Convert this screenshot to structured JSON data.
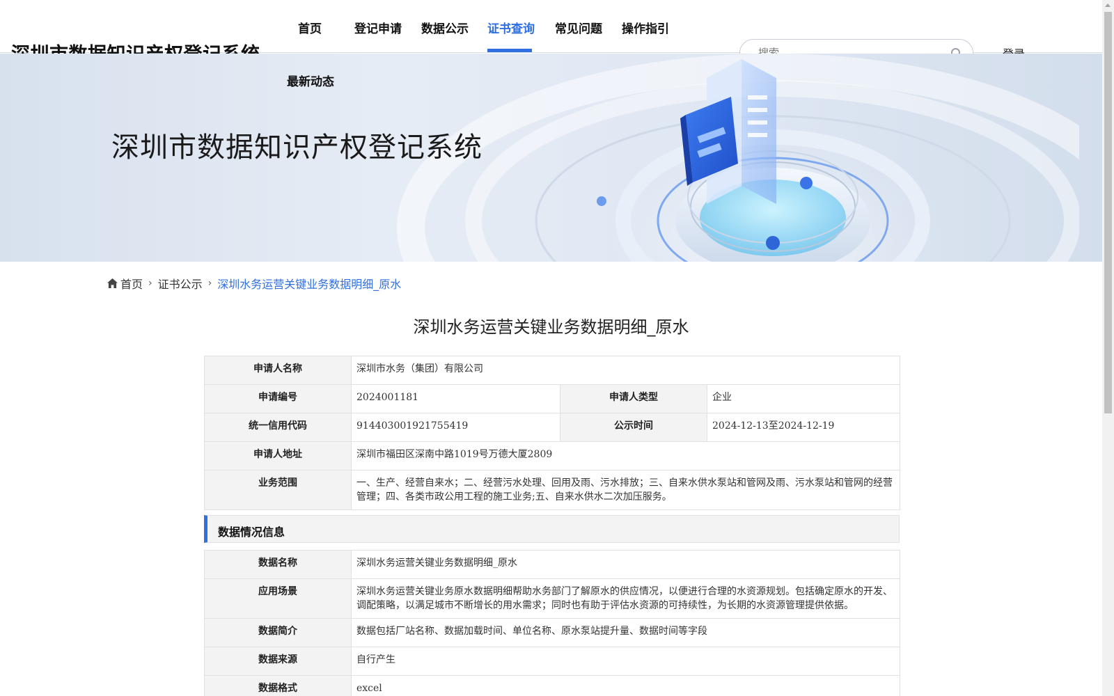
{
  "header": {
    "site_title": "深圳市数据知识产权登记系统",
    "nav": [
      {
        "label": "首页"
      },
      {
        "label": "登记申请"
      },
      {
        "label": "数据公示"
      },
      {
        "label": "证书查询",
        "active": true
      },
      {
        "label": "常见问题"
      },
      {
        "label": "操作指引"
      },
      {
        "label": "最新动态"
      }
    ],
    "search_placeholder": "搜索",
    "login_label": "登录",
    "accent_color": "#2f6fe0"
  },
  "banner": {
    "title": "深圳市数据知识产权登记系统"
  },
  "breadcrumb": {
    "home": "首页",
    "level2": "证书公示",
    "current": "深圳水务运营关键业务数据明细_原水"
  },
  "page_title": "深圳水务运营关键业务数据明细_原水",
  "applicant": {
    "name_label": "申请人名称",
    "name": "深圳市水务（集团）有限公司",
    "number_label": "申请编号",
    "number": "2024001181",
    "type_label": "申请人类型",
    "type": "企业",
    "credit_code_label": "统一信用代码",
    "credit_code": "914403001921755419",
    "publicity_label": "公示时间",
    "publicity_period": "2024-12-13至2024-12-19",
    "address_label": "申请人地址",
    "address": "深圳市福田区深南中路1019号万德大厦2809",
    "scope_label": "业务范围",
    "scope": "一、生产、经营自来水；二、经营污水处理、回用及雨、污水排放；三、自来水供水泵站和管网及雨、污水泵站和管网的经营管理；四、各类市政公用工程的施工业务;五、自来水供水二次加压服务。"
  },
  "data_section": {
    "title": "数据情况信息",
    "rows": [
      {
        "label": "数据名称",
        "value": "深圳水务运营关键业务数据明细_原水"
      },
      {
        "label": "应用场景",
        "value": "深圳水务运营关键业务原水数据明细帮助水务部门了解原水的供应情况，以便进行合理的水资源规划。包括确定原水的开发、调配策略，以满足城市不断增长的用水需求；同时也有助于评估水资源的可持续性，为长期的水资源管理提供依据。"
      },
      {
        "label": "数据简介",
        "value": "数据包括厂站名称、数据加载时间、单位名称、原水泵站提升量、数据时间等字段"
      },
      {
        "label": "数据来源",
        "value": "自行产生"
      },
      {
        "label": "数据格式",
        "value": "excel"
      }
    ]
  }
}
